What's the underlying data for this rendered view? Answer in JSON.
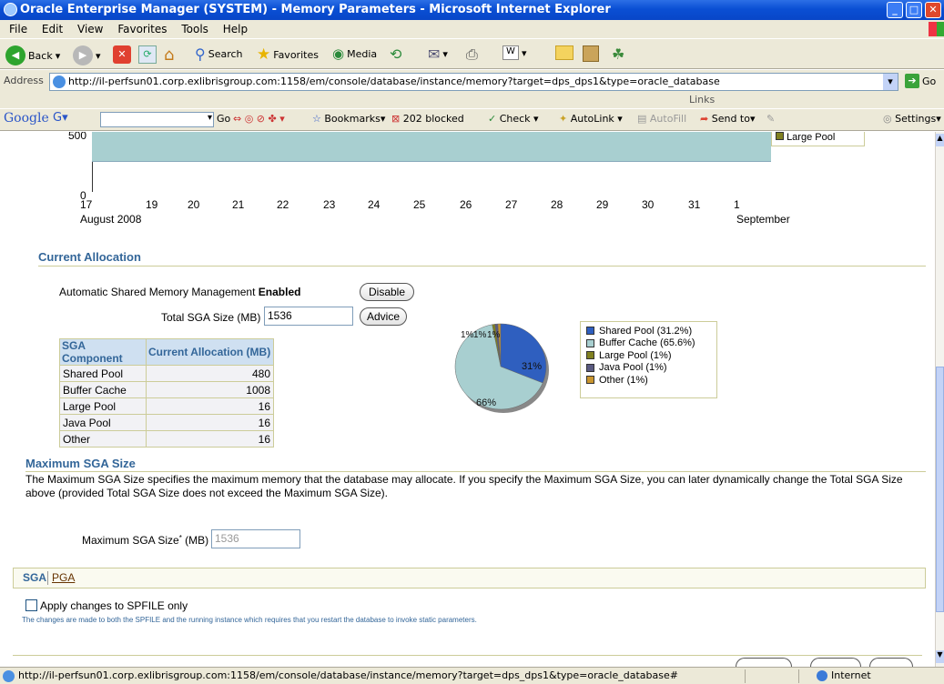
{
  "window": {
    "title": "Oracle Enterprise Manager (SYSTEM) - Memory Parameters - Microsoft Internet Explorer"
  },
  "menu": [
    "File",
    "Edit",
    "View",
    "Favorites",
    "Tools",
    "Help"
  ],
  "toolbar": {
    "back": "Back",
    "search": "Search",
    "favorites": "Favorites",
    "media": "Media"
  },
  "address": {
    "label": "Address",
    "url": "http://il-perfsun01.corp.exlibrisgroup.com:1158/em/console/database/instance/memory?target=dps_dps1&type=oracle_database",
    "go": "Go",
    "links": "Links"
  },
  "googlebar": {
    "go": "Go",
    "bookmarks": "Bookmarks",
    "blocked": "202 blocked",
    "check": "Check",
    "autolink": "AutoLink",
    "autofill": "AutoFill",
    "sendto": "Send to",
    "settings": "Settings"
  },
  "history_chart": {
    "y_ticks": [
      "500",
      "0"
    ],
    "x_ticks": [
      "17",
      "19",
      "20",
      "21",
      "22",
      "23",
      "24",
      "25",
      "26",
      "27",
      "28",
      "29",
      "30",
      "31",
      "1"
    ],
    "month_start": "August 2008",
    "month_end": "September",
    "legend_partial": "Large Pool"
  },
  "current_allocation": {
    "title": "Current Allocation",
    "asmm_label": "Automatic Shared Memory Management",
    "asmm_status": "Enabled",
    "disable_button": "Disable",
    "total_sga_label": "Total SGA Size (MB)",
    "total_sga_value": "1536",
    "advice_button": "Advice",
    "table_headers": [
      "SGA Component",
      "Current Allocation (MB)"
    ],
    "rows": [
      {
        "component": "Shared Pool",
        "mb": "480"
      },
      {
        "component": "Buffer Cache",
        "mb": "1008"
      },
      {
        "component": "Large Pool",
        "mb": "16"
      },
      {
        "component": "Java Pool",
        "mb": "16"
      },
      {
        "component": "Other",
        "mb": "16"
      }
    ]
  },
  "chart_data": {
    "type": "pie",
    "slices": [
      {
        "label": "Shared Pool (31.2%)",
        "value": 31.2,
        "color": "#2f5fbf"
      },
      {
        "label": "Buffer Cache (65.6%)",
        "value": 65.6,
        "color": "#a8cfd0"
      },
      {
        "label": "Large Pool (1%)",
        "value": 1,
        "color": "#808020"
      },
      {
        "label": "Java Pool (1%)",
        "value": 1,
        "color": "#5a5a80"
      },
      {
        "label": "Other (1%)",
        "value": 1,
        "color": "#c9952e"
      }
    ],
    "data_labels": [
      "31%",
      "66%",
      "1%",
      "1%",
      "1%"
    ],
    "legend_placement": "right"
  },
  "max_sga": {
    "title": "Maximum SGA Size",
    "description": "The Maximum SGA Size specifies the maximum memory that the database may allocate. If you specify the Maximum SGA Size, you can later dynamically change the Total SGA Size above (provided Total SGA Size does not exceed the Maximum SGA Size).",
    "field_label": "Maximum SGA Size",
    "field_unit": "(MB)",
    "field_value": "1536"
  },
  "tabs": [
    "SGA",
    "PGA"
  ],
  "spfile": {
    "checkbox_label": "Apply changes to SPFILE only",
    "note": "The changes are made to both the SPFILE and the running instance which requires that you restart the database to invoke static parameters."
  },
  "status": {
    "url": "http://il-perfsun01.corp.exlibrisgroup.com:1158/em/console/database/instance/memory?target=dps_dps1&type=oracle_database#",
    "zone": "Internet"
  }
}
